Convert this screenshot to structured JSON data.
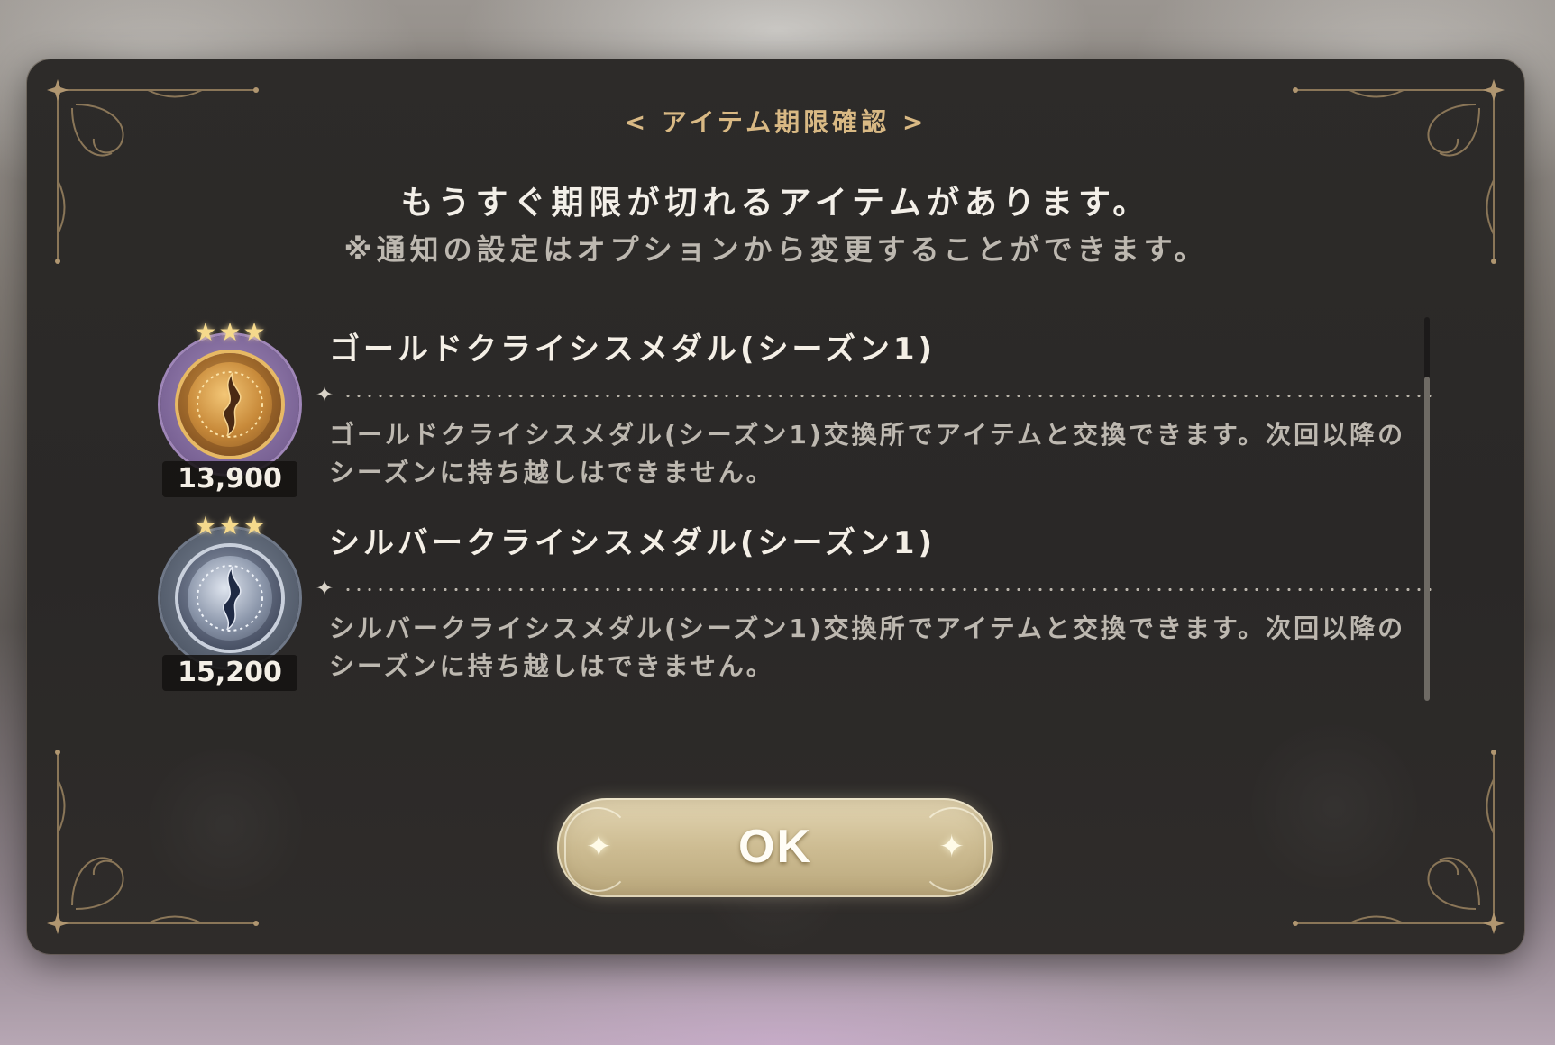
{
  "dialog": {
    "title": "< アイテム期限確認 >",
    "headline": "もうすぐ期限が切れるアイテムがあります。",
    "subline": "※通知の設定はオプションから変更することができます。",
    "ok_label": "OK"
  },
  "items": [
    {
      "name": "ゴールドクライシスメダル(シーズン1)",
      "count": "13,900",
      "description": "ゴールドクライシスメダル(シーズン1)交換所でアイテムと交換できます。次回以降のシーズンに持ち越しはできません。",
      "icon": "gold-crisis-medal-icon",
      "stars": "★★★",
      "frame_color": "#8e77a6",
      "coin_color": "#c88a3a"
    },
    {
      "name": "シルバークライシスメダル(シーズン1)",
      "count": "15,200",
      "description": "シルバークライシスメダル(シーズン1)交換所でアイテムと交換できます。次回以降のシーズンに持ち越しはできません。",
      "icon": "silver-crisis-medal-icon",
      "stars": "★★★",
      "frame_color": "#5f6878",
      "coin_color": "#8c97ab"
    }
  ],
  "colors": {
    "panel": "#2b2928",
    "accent_gold": "#d9b984",
    "text_primary": "#f4efe6",
    "text_secondary": "#bdb8b0",
    "button": "#cdbc92"
  }
}
